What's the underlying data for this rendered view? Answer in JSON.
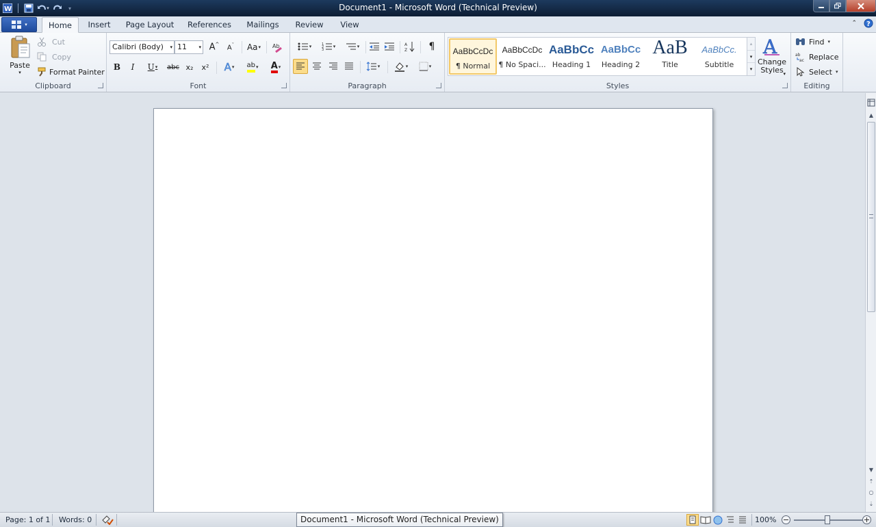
{
  "window": {
    "title": "Document1  -  Microsoft Word (Technical Preview)"
  },
  "quick_access": {
    "icons": [
      "word-logo-icon",
      "save-icon",
      "undo-icon",
      "redo-icon"
    ]
  },
  "tabs": [
    {
      "label": "Home",
      "active": true
    },
    {
      "label": "Insert"
    },
    {
      "label": "Page Layout"
    },
    {
      "label": "References"
    },
    {
      "label": "Mailings"
    },
    {
      "label": "Review"
    },
    {
      "label": "View"
    }
  ],
  "clipboard": {
    "group_label": "Clipboard",
    "paste": "Paste",
    "cut": "Cut",
    "copy": "Copy",
    "format_painter": "Format Painter"
  },
  "font": {
    "group_label": "Font",
    "font_name": "Calibri (Body)",
    "font_size": "11",
    "case_label": "Aa",
    "bold": "B",
    "italic": "I",
    "underline": "U",
    "strike": "abc",
    "subscript": "x₂",
    "superscript": "x²",
    "text_effects": "A",
    "highlight": "ab",
    "font_color": "A",
    "highlight_color": "#ffff00",
    "font_color_value": "#e00000"
  },
  "paragraph": {
    "group_label": "Paragraph",
    "pilcrow": "¶"
  },
  "styles": {
    "group_label": "Styles",
    "items": [
      {
        "preview": "AaBbCcDc",
        "label": "¶ Normal",
        "selected": true
      },
      {
        "preview": "AaBbCcDc",
        "label": "¶ No Spaci..."
      },
      {
        "preview": "AaBbCc",
        "label": "Heading 1"
      },
      {
        "preview": "AaBbCc",
        "label": "Heading 2"
      },
      {
        "preview": "AaB",
        "label": "Title"
      },
      {
        "preview": "AaBbCc.",
        "label": "Subtitle"
      }
    ],
    "change_styles": "Change Styles"
  },
  "editing": {
    "group_label": "Editing",
    "find": "Find",
    "replace": "Replace",
    "select": "Select"
  },
  "status": {
    "page": "Page: 1 of 1",
    "words": "Words: 0",
    "zoom": "100%",
    "tooltip": "Document1 - Microsoft Word (Technical Preview)"
  }
}
